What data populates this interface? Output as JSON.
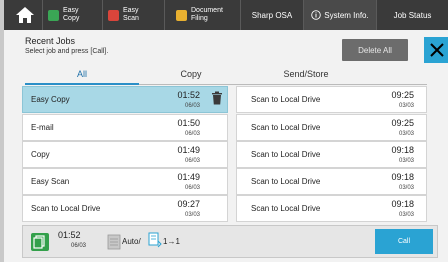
{
  "topbar": {
    "easy_copy": "Easy\nCopy",
    "easy_copy_l1": "Easy",
    "easy_copy_l2": "Copy",
    "easy_scan_l1": "Easy",
    "easy_scan_l2": "Scan",
    "doc_filing_l1": "Document",
    "doc_filing_l2": "Filing",
    "sharp_osa": "Sharp OSA",
    "system_info": "System Info.",
    "job_status": "Job Status"
  },
  "header": {
    "title": "Recent Jobs",
    "subtitle": "Select job and press [Call].",
    "delete_all": "Delete All"
  },
  "tabs": [
    "All",
    "Copy",
    "Send/Store"
  ],
  "left_jobs": [
    {
      "name": "Easy Copy",
      "time": "01:52",
      "date": "06/03",
      "selected": true
    },
    {
      "name": "E-mail",
      "time": "01:50",
      "date": "06/03"
    },
    {
      "name": "Copy",
      "time": "01:49",
      "date": "06/03"
    },
    {
      "name": "Easy Scan",
      "time": "01:49",
      "date": "06/03"
    },
    {
      "name": "Scan to Local Drive",
      "time": "09:27",
      "date": "03/03"
    }
  ],
  "right_jobs": [
    {
      "name": "Scan to Local Drive",
      "time": "09:25",
      "date": "03/03"
    },
    {
      "name": "Scan to Local Drive",
      "time": "09:25",
      "date": "03/03"
    },
    {
      "name": "Scan to Local Drive",
      "time": "09:18",
      "date": "03/03"
    },
    {
      "name": "Scan to Local Drive",
      "time": "09:18",
      "date": "03/03"
    },
    {
      "name": "Scan to Local Drive",
      "time": "09:18",
      "date": "03/03"
    }
  ],
  "bottom": {
    "time": "01:52",
    "date": "06/03",
    "auto": "Auto/",
    "duplex": "1→1",
    "call": "Call"
  },
  "colors": {
    "accent": "#2aa3d3",
    "selected_row": "#a8d8e6",
    "topbar": "#3a3a3a"
  }
}
